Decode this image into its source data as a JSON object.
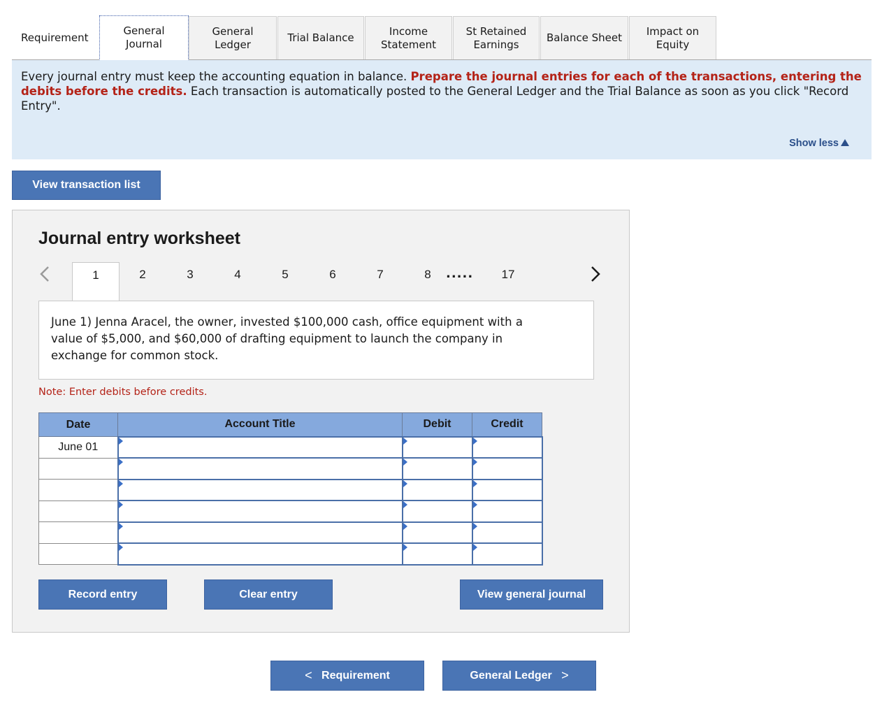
{
  "tabs": [
    {
      "label_line1": "Requirement",
      "label_line2": "",
      "active": false
    },
    {
      "label_line1": "General",
      "label_line2": "Journal",
      "active": true
    },
    {
      "label_line1": "General",
      "label_line2": "Ledger",
      "active": false
    },
    {
      "label_line1": "Trial Balance",
      "label_line2": "",
      "active": false
    },
    {
      "label_line1": "Income",
      "label_line2": "Statement",
      "active": false
    },
    {
      "label_line1": "St Retained",
      "label_line2": "Earnings",
      "active": false
    },
    {
      "label_line1": "Balance Sheet",
      "label_line2": "",
      "active": false
    },
    {
      "label_line1": "Impact on",
      "label_line2": "Equity",
      "active": false
    }
  ],
  "instructions": {
    "text_before": "Every journal entry must keep the accounting equation in balance. ",
    "text_red": "Prepare the journal entries for each of the transactions, entering the debits before the credits.",
    "text_after": " Each transaction is automatically posted to the General Ledger and the Trial Balance as soon as you click \"Record Entry\".",
    "show_less_label": "Show less"
  },
  "view_transaction_list_label": "View transaction list",
  "worksheet": {
    "title": "Journal entry worksheet",
    "pages": [
      "1",
      "2",
      "3",
      "4",
      "5",
      "6",
      "7",
      "8"
    ],
    "ellipsis": ".....",
    "last_page": "17",
    "current_page": "1",
    "transaction_text": "June 1) Jenna Aracel, the owner, invested $100,000 cash, office equipment with a value of $5,000, and $60,000 of drafting equipment to launch the company in exchange for common stock.",
    "note": "Note: Enter debits before credits.",
    "columns": [
      "Date",
      "Account Title",
      "Debit",
      "Credit"
    ],
    "rows": [
      {
        "date": "June 01",
        "account": "",
        "debit": "",
        "credit": ""
      },
      {
        "date": "",
        "account": "",
        "debit": "",
        "credit": ""
      },
      {
        "date": "",
        "account": "",
        "debit": "",
        "credit": ""
      },
      {
        "date": "",
        "account": "",
        "debit": "",
        "credit": ""
      },
      {
        "date": "",
        "account": "",
        "debit": "",
        "credit": ""
      },
      {
        "date": "",
        "account": "",
        "debit": "",
        "credit": ""
      }
    ],
    "record_entry_label": "Record entry",
    "clear_entry_label": "Clear entry",
    "view_general_journal_label": "View general journal"
  },
  "bottom_nav": {
    "prev_label": "Requirement",
    "next_label": "General Ledger"
  }
}
